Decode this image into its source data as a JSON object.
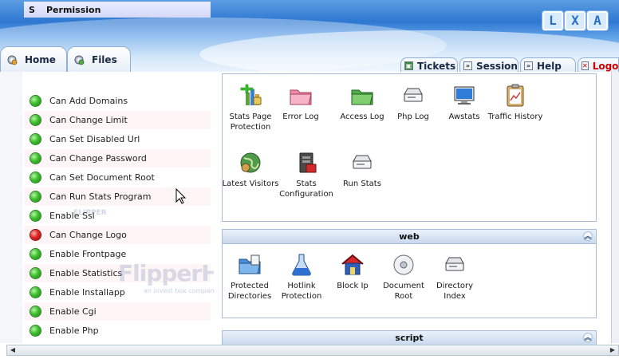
{
  "logo_letters": [
    "L",
    "X",
    "A"
  ],
  "left_tabs": [
    {
      "label": "Home",
      "icon": "gear-icon"
    },
    {
      "label": "Files",
      "icon": "gear-icon"
    }
  ],
  "right_tabs": [
    {
      "label": "Tickets",
      "icon": "tickets-icon"
    },
    {
      "label": "Session",
      "icon": "session-icon"
    },
    {
      "label": "Help",
      "icon": "help-icon"
    },
    {
      "label": "Logou",
      "icon": "logout-icon"
    }
  ],
  "permissions": {
    "header_s": "S",
    "header_permission": "Permission",
    "rows": [
      {
        "label": "Can Add Domains",
        "status": "green"
      },
      {
        "label": "Can Change Limit",
        "status": "green"
      },
      {
        "label": "Can Set Disabled Url",
        "status": "green"
      },
      {
        "label": "Can Change Password",
        "status": "green"
      },
      {
        "label": "Can Set Document Root",
        "status": "green"
      },
      {
        "label": "Can Run Stats Program",
        "status": "green"
      },
      {
        "label": "Enable Ssl",
        "status": "green"
      },
      {
        "label": "Can Change Logo",
        "status": "red"
      },
      {
        "label": "Enable Frontpage",
        "status": "green"
      },
      {
        "label": "Enable Statistics",
        "status": "green"
      },
      {
        "label": "Enable Installapp",
        "status": "green"
      },
      {
        "label": "Enable Cgi",
        "status": "green"
      },
      {
        "label": "Enable Php",
        "status": "green"
      }
    ]
  },
  "watermark": {
    "text": "FlipperHost",
    "sub": "an invest box company",
    "small": "FLIPPER"
  },
  "stats_box": {
    "items": [
      {
        "label": "Stats Page Protection",
        "icon": "stats-protection-icon"
      },
      {
        "label": "Error Log",
        "icon": "error-log-folder-icon"
      },
      {
        "label": "Access Log",
        "icon": "access-log-folder-icon"
      },
      {
        "label": "Php Log",
        "icon": "php-log-drive-icon"
      },
      {
        "label": "Awstats",
        "icon": "awstats-monitor-icon"
      },
      {
        "label": "Traffic History",
        "icon": "traffic-history-clipboard-icon"
      },
      {
        "label": "Latest Visitors",
        "icon": "latest-visitors-globe-icon"
      },
      {
        "label": "Stats Configuration",
        "icon": "stats-configuration-icon"
      },
      {
        "label": "Run Stats",
        "icon": "run-stats-drive-icon"
      }
    ]
  },
  "web_box": {
    "title": "web",
    "items": [
      {
        "label": "Protected Directories",
        "icon": "protected-directories-icon"
      },
      {
        "label": "Hotlink Protection",
        "icon": "hotlink-flask-icon"
      },
      {
        "label": "Block Ip",
        "icon": "block-ip-house-icon"
      },
      {
        "label": "Document Root",
        "icon": "document-root-disc-icon"
      },
      {
        "label": "Directory Index",
        "icon": "directory-index-drive-icon"
      }
    ]
  },
  "script_box": {
    "title": "script"
  },
  "colors": {
    "accent": "#2e78d2",
    "green_status": "#3cbf2c",
    "red_status": "#e02222",
    "logout": "#cc0000"
  }
}
